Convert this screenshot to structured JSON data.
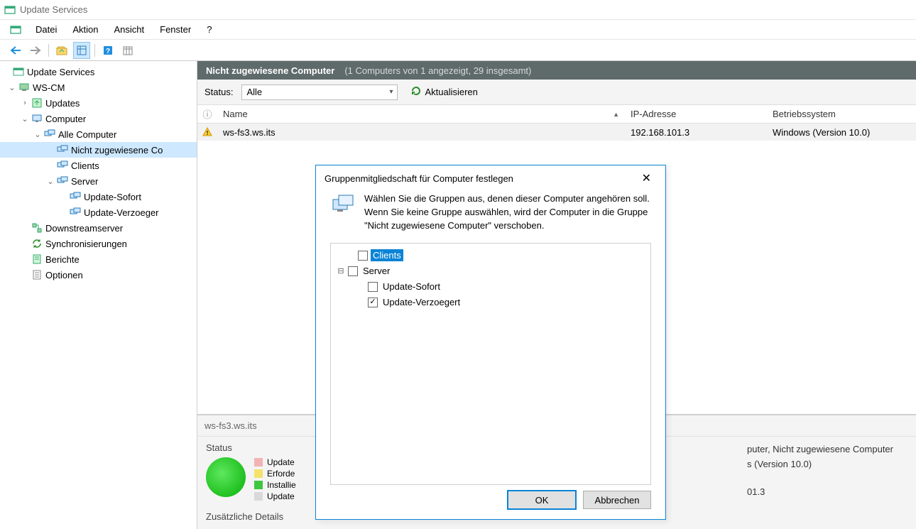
{
  "window": {
    "title": "Update Services"
  },
  "menu": {
    "file": "Datei",
    "action": "Aktion",
    "view": "Ansicht",
    "window_m": "Fenster",
    "help": "?"
  },
  "tree": {
    "root": "Update Services",
    "server": "WS-CM",
    "updates": "Updates",
    "computer": "Computer",
    "all": "Alle Computer",
    "unassigned": "Nicht zugewiesene Co",
    "clients": "Clients",
    "srv": "Server",
    "upd_now": "Update-Sofort",
    "upd_del": "Update-Verzoeger",
    "downstream": "Downstreamserver",
    "sync": "Synchronisierungen",
    "reports": "Berichte",
    "options": "Optionen"
  },
  "content": {
    "title": "Nicht zugewiesene Computer",
    "sub": "(1 Computers von 1 angezeigt, 29 insgesamt)",
    "status_label": "Status:",
    "status_val": "Alle",
    "refresh": "Aktualisieren",
    "cols": {
      "name": "Name",
      "ip": "IP-Adresse",
      "os": "Betriebssystem"
    },
    "row": {
      "name": "ws-fs3.ws.its",
      "ip": "192.168.101.3",
      "os": "Windows (Version 10.0)"
    }
  },
  "detail": {
    "name": "ws-fs3.ws.its",
    "status": "Status",
    "legend": {
      "a": "Update",
      "b": "Erforde",
      "c": "Installie",
      "d": "Update"
    },
    "right1": "puter, Nicht zugewiesene Computer",
    "right2": "s (Version 10.0)",
    "right3": "01.3",
    "extra": "Zusätzliche Details"
  },
  "dialog": {
    "title": "Gruppenmitgliedschaft für Computer festlegen",
    "desc": "Wählen Sie die Gruppen aus, denen dieser Computer angehören soll. Wenn Sie keine Gruppe auswählen, wird der Computer in die Gruppe \"Nicht zugewiesene Computer\" verschoben.",
    "n_clients": "Clients",
    "n_server": "Server",
    "n_now": "Update-Sofort",
    "n_del": "Update-Verzoegert",
    "ok": "OK",
    "cancel": "Abbrechen"
  }
}
